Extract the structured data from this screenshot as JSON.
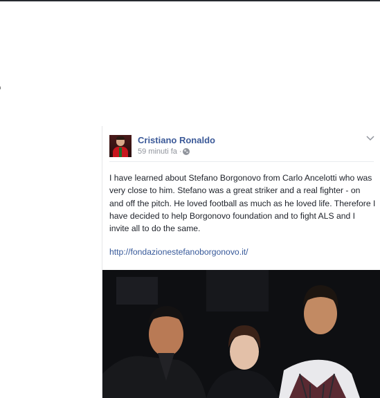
{
  "post": {
    "author": "Cristiano Ronaldo",
    "timestamp": "59 minuti fa",
    "separator": "·",
    "body": "I have learned about Stefano Borgonovo from Carlo Ancelotti who was very close to him. Stefano was a great striker and a real fighter - on and off the pitch. He loved football as much as he loved life. Therefore I have decided to help Borgonovo foundation and to fight ALS and I invite all to do the same.",
    "link": "http://fondazionestefanoborgonovo.it/",
    "options_icon": "chevron-down-icon",
    "audience_icon": "globe-icon"
  },
  "colors": {
    "author_link": "#3b5998",
    "link": "#365899",
    "meta": "#90949c",
    "body_text": "#1d2129"
  }
}
